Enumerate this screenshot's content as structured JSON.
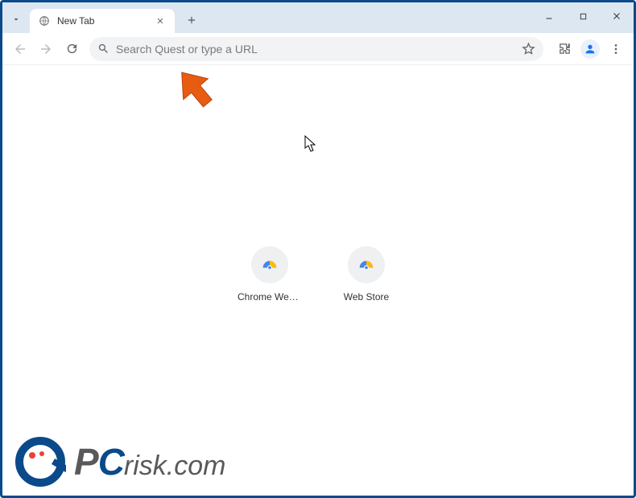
{
  "window": {
    "minimize": "—",
    "maximize": "▢",
    "close": "×"
  },
  "tab": {
    "title": "New Tab",
    "favicon": "globe-icon",
    "close": "×",
    "new": "+"
  },
  "toolbar": {
    "omnibox_placeholder": "Search Quest or type a URL"
  },
  "shortcuts": [
    {
      "label": "Chrome Web..."
    },
    {
      "label": "Web Store"
    }
  ],
  "watermark": {
    "brand_pc": "PC",
    "brand_rest": "risk.com"
  },
  "colors": {
    "accent": "#1a73e8",
    "frame": "#0a4a8a",
    "arrow": "#e85b12"
  }
}
